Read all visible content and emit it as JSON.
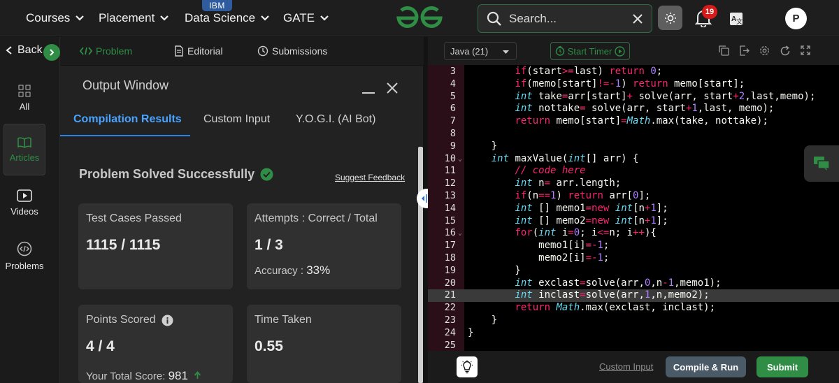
{
  "nav": {
    "items": [
      {
        "label": "Courses"
      },
      {
        "label": "Placement"
      },
      {
        "label": "Data Science",
        "badge": "IBM"
      },
      {
        "label": "GATE"
      }
    ],
    "search_placeholder": "Search...",
    "notifications": "19",
    "avatar": "P",
    "brand_color": "#2f8d46"
  },
  "sidebar": {
    "back": "Back",
    "items": [
      {
        "label": "All",
        "icon": "grid-icon"
      },
      {
        "label": "Articles",
        "icon": "book-icon",
        "active": true
      },
      {
        "label": "Videos",
        "icon": "video-icon"
      },
      {
        "label": "Problems",
        "icon": "code-icon"
      }
    ]
  },
  "problem_tabs": [
    {
      "label": "Problem",
      "active": true
    },
    {
      "label": "Editorial"
    },
    {
      "label": "Submissions"
    }
  ],
  "output": {
    "title": "Output Window",
    "tabs": [
      {
        "label": "Compilation Results",
        "active": true
      },
      {
        "label": "Custom Input"
      },
      {
        "label": "Y.O.G.I. (AI Bot)"
      }
    ],
    "status": "Problem Solved Successfully",
    "feedback": "Suggest Feedback",
    "cards": {
      "tests": {
        "label": "Test Cases Passed",
        "value": "1115 / 1115"
      },
      "attempts": {
        "label": "Attempts : Correct / Total",
        "value": "1 / 3",
        "accuracy_label": "Accuracy :",
        "accuracy": "33%"
      },
      "points": {
        "label": "Points Scored",
        "value": "4 / 4",
        "total_label": "Your Total Score:",
        "total": "981"
      },
      "time": {
        "label": "Time Taken",
        "value": "0.55"
      }
    }
  },
  "editor": {
    "language": "Java (21)",
    "timer": "Start Timer",
    "highlight_line": 21,
    "lines": [
      {
        "n": "3",
        "t": "        if(start>=last) return 0;"
      },
      {
        "n": "4",
        "t": "        if(memo[start]!=-1) return memo[start];"
      },
      {
        "n": "5",
        "t": "        int take=arr[start]+ solve(arr, start+2,last,memo);"
      },
      {
        "n": "6",
        "t": "        int nottake= solve(arr, start+1,last, memo);"
      },
      {
        "n": "7",
        "t": "        return memo[start]=Math.max(take, nottake);"
      },
      {
        "n": "8",
        "t": ""
      },
      {
        "n": "9",
        "t": "    }"
      },
      {
        "n": "10",
        "t": "    int maxValue(int[] arr) {",
        "fold": true
      },
      {
        "n": "11",
        "t": "        // code here"
      },
      {
        "n": "12",
        "t": "        int n= arr.length;"
      },
      {
        "n": "13",
        "t": "        if(n==1) return arr[0];"
      },
      {
        "n": "14",
        "t": "        int [] memo1=new int[n+1];"
      },
      {
        "n": "15",
        "t": "        int [] memo2=new int[n+1];"
      },
      {
        "n": "16",
        "t": "        for(int i=0; i<=n; i++){",
        "fold": true
      },
      {
        "n": "17",
        "t": "            memo1[i]=-1;"
      },
      {
        "n": "18",
        "t": "            memo2[i]=-1;"
      },
      {
        "n": "19",
        "t": "        }"
      },
      {
        "n": "20",
        "t": "        int exclast=solve(arr,0,n-1,memo1);"
      },
      {
        "n": "21",
        "t": "        int inclast=solve(arr,1,n,memo2);"
      },
      {
        "n": "22",
        "t": "        return Math.max(exclast, inclast);"
      },
      {
        "n": "23",
        "t": "    }"
      },
      {
        "n": "24",
        "t": "}"
      },
      {
        "n": "25",
        "t": ""
      }
    ]
  },
  "bottom": {
    "custom_input": "Custom Input",
    "compile": "Compile & Run",
    "submit": "Submit"
  }
}
